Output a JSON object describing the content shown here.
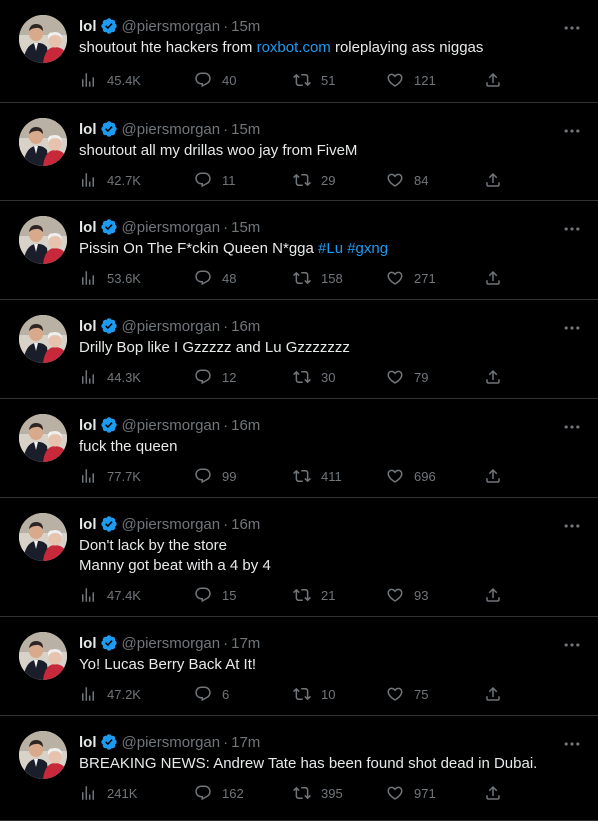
{
  "colors": {
    "background": "#000000",
    "text": "#e7e9ea",
    "muted": "#71767b",
    "link": "#1d9bf0",
    "verified": "#1d9bf0",
    "divider": "#2f3336"
  },
  "icons": {
    "views": "views-bar-chart-icon",
    "reply": "reply-bubble-icon",
    "retweet": "retweet-icon",
    "like": "heart-icon",
    "share": "share-upload-icon",
    "more": "more-dots-icon",
    "verified": "verified-badge-icon"
  },
  "tweets": [
    {
      "name": "lol",
      "handle": "@piersmorgan",
      "separator": "·",
      "time": "15m",
      "segments": [
        {
          "t": "shoutout hte hackers from "
        },
        {
          "t": "roxbot.com",
          "link": true
        },
        {
          "t": " roleplaying ass niggas"
        }
      ],
      "views": "45.4K",
      "replies": "40",
      "retweets": "51",
      "likes": "121"
    },
    {
      "name": "lol",
      "handle": "@piersmorgan",
      "separator": "·",
      "time": "15m",
      "segments": [
        {
          "t": "shoutout all my drillas woo jay from FiveM"
        }
      ],
      "views": "42.7K",
      "replies": "11",
      "retweets": "29",
      "likes": "84"
    },
    {
      "name": "lol",
      "handle": "@piersmorgan",
      "separator": "·",
      "time": "15m",
      "segments": [
        {
          "t": "Pissin On The F*ckin Queen N*gga "
        },
        {
          "t": "#Lu",
          "link": true
        },
        {
          "t": " "
        },
        {
          "t": "#gxng",
          "link": true
        }
      ],
      "views": "53.6K",
      "replies": "48",
      "retweets": "158",
      "likes": "271"
    },
    {
      "name": "lol",
      "handle": "@piersmorgan",
      "separator": "·",
      "time": "16m",
      "segments": [
        {
          "t": "Drilly Bop like I Gzzzzz and Lu Gzzzzzzz"
        }
      ],
      "views": "44.3K",
      "replies": "12",
      "retweets": "30",
      "likes": "79"
    },
    {
      "name": "lol",
      "handle": "@piersmorgan",
      "separator": "·",
      "time": "16m",
      "segments": [
        {
          "t": "fuck the queen"
        }
      ],
      "views": "77.7K",
      "replies": "99",
      "retweets": "411",
      "likes": "696"
    },
    {
      "name": "lol",
      "handle": "@piersmorgan",
      "separator": "·",
      "time": "16m",
      "segments": [
        {
          "t": "Don't lack by the store\nManny got beat with a 4 by 4"
        }
      ],
      "views": "47.4K",
      "replies": "15",
      "retweets": "21",
      "likes": "93"
    },
    {
      "name": "lol",
      "handle": "@piersmorgan",
      "separator": "·",
      "time": "17m",
      "segments": [
        {
          "t": "Yo! Lucas Berry Back At It!"
        }
      ],
      "views": "47.2K",
      "replies": "6",
      "retweets": "10",
      "likes": "75"
    },
    {
      "name": "lol",
      "handle": "@piersmorgan",
      "separator": "·",
      "time": "17m",
      "segments": [
        {
          "t": "BREAKING NEWS: Andrew Tate has been found shot dead in Dubai."
        }
      ],
      "views": "241K",
      "replies": "162",
      "retweets": "395",
      "likes": "971"
    }
  ]
}
